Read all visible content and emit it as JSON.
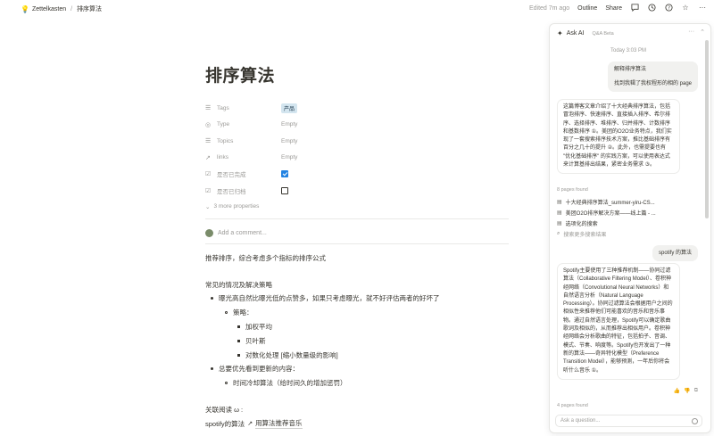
{
  "topbar": {
    "workspace": "Zettelkasten",
    "separator": "/",
    "page": "排序算法",
    "edited": "Edited 7m ago",
    "outline": "Outline",
    "share": "Share"
  },
  "doc": {
    "title": "排序算法",
    "properties": [
      {
        "icon": "list-icon",
        "name": "Tags",
        "value": "产品",
        "kind": "tag"
      },
      {
        "icon": "circle-icon",
        "name": "Type",
        "value": "Empty",
        "kind": "text"
      },
      {
        "icon": "list-icon",
        "name": "Topics",
        "value": "Empty",
        "kind": "text"
      },
      {
        "icon": "link-icon",
        "name": "links",
        "value": "Empty",
        "kind": "text"
      },
      {
        "icon": "checkbox-icon",
        "name": "是否已完成",
        "value": true,
        "kind": "checkbox"
      },
      {
        "icon": "checkbox-icon",
        "name": "是否已归档",
        "value": false,
        "kind": "checkbox"
      }
    ],
    "more_props": "3 more properties",
    "comment_placeholder": "Add a comment...",
    "para1": "推荐排序，综合考虑多个指标的排序公式",
    "heading": "常见的情况及解决策略",
    "b1": "曝光高自然比曝光低的点赞多，如果只考虑曝光，就不好评估两者的好坏了",
    "b1_1": "策略：",
    "b1_1_1": "加权平均",
    "b1_1_2": "贝叶斯",
    "b1_1_3": "对数化处理 [缩小数量级的影响]",
    "b2": "总要优先看到更新的内容：",
    "b2_1": "时间冷却算法（给时间久的增加惩罚）",
    "related": "关联阅读 ω :",
    "spotify_prefix": "spotify的算法",
    "spotify_link": "用算法推荐音乐"
  },
  "ai": {
    "title": "Ask AI",
    "beta": "Q&A Beta",
    "time": "Today 3:03 PM",
    "user1": "解释排序算法",
    "user2": "找到我辑了我权程形的相的 page",
    "answer1": "这篇博客文章介绍了十大经典排序算法，包括冒泡排序、快速排序、直接插入排序、希尔排序、选择排序、堆排序、归并排序、计数排序和基数排序 ①。美团的O2O业务特点，我们实现了一套搜索排序技术方案，推比基础排序有百分之几十的提升 ②。此外，也需提要也有 \"优化基础排序\" 的实践方案，可以使用表达式来计算基排出结果，紧密业务需求 ③。",
    "pages_found1": "8 pages found",
    "sources": [
      "十大经典排序算法_summer-yiru-CS...",
      "美团O2O排序解决方案——线上篇 - ...",
      "选项化的搜索"
    ],
    "more_sources": "搜索更多搜索结果",
    "user3": "spotify 的算法",
    "answer2": "Spotify主要使用了三种推荐机制——协同过滤算法（Collaborative Filtering Model）、卷积神经网络（Convolutional Neural Networks）和自然语言分析（Natural Language Processing）。协同过滤算法会根据用户之间的相似性来推荐他们可能喜欢的音乐和音乐事物。通过自然语言处理，Spotify可以确定歌曲歌词及相似的，从而推荐出相似用户。卷积神经网络会分析歌曲的特征，包括拍子、音调、模式、节奏、响度等。Spotify也开发出了一种新的算法——奇异特化模型（Preference Transition Model），能够预测，一年后你将会听什么音乐 ①。",
    "pages_found2": "4 pages found",
    "input_placeholder": "Ask a question...",
    "accent": "#2383e2"
  }
}
